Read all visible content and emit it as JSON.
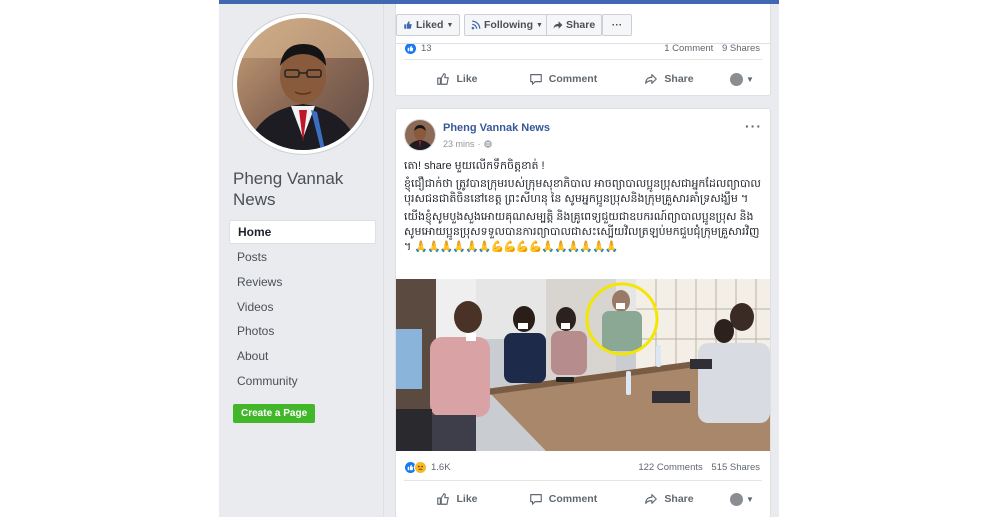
{
  "page": {
    "name": "Pheng Vannak News",
    "nav": [
      "Home",
      "Posts",
      "Reviews",
      "Videos",
      "Photos",
      "About",
      "Community"
    ],
    "create_page_label": "Create a Page"
  },
  "action_bar": {
    "liked_label": "Liked",
    "following_label": "Following",
    "share_label": "Share",
    "more_label": "···"
  },
  "prev_post": {
    "reaction_count": "13",
    "comments": "1 Comment",
    "shares": "9 Shares",
    "actions": [
      "Like",
      "Comment",
      "Share"
    ]
  },
  "post": {
    "author": "Pheng Vannak News",
    "time": "23 mins",
    "privacy_icon": "globe-icon",
    "text_line1": "តោ! share មួយលើកទឹកចិត្តខាត់ !",
    "text_para2": "ខ្ញុំជឿជាក់ថា ត្រូវបានក្រុមរបស់ក្រុមសុខាភិបាល អាចព្យាបាលប្អូនប្រុសជាអ្នកដែលព្យាបាលបុរសជនជាតិចិននៅខេត្ត ព្រះសីហនុ នៃ សូមអ្នកប្អូនប្រុសនិងក្រុមគ្រួសារគាំទ្រសង្ឃឹម ។",
    "text_para3": "យើងខ្ញុំសូមបួងសួងអោយគុណសម្បត្តិ និងគ្រូពេទ្យជួយជាឧបករណ៍ព្យាបាលប្អូនប្រុស និងសូមអោយប្អូនប្រុសទទួលបានការព្យាបាលជាសះស្បើយវិលត្រឡប់មកជួបជុំក្រុមគ្រួសារវិញ ។",
    "text_emoji": "🙏🙏🙏🙏🙏🙏💪💪💪💪🙏🙏🙏🙏🙏🙏",
    "reaction_count": "1.6K",
    "comments": "122 Comments",
    "shares": "515 Shares",
    "actions": [
      "Like",
      "Comment",
      "Share"
    ]
  },
  "colors": {
    "fb_blue": "#4267b2",
    "link_blue": "#385898",
    "create_green": "#42b72a",
    "highlight_circle": "#f3e600"
  }
}
